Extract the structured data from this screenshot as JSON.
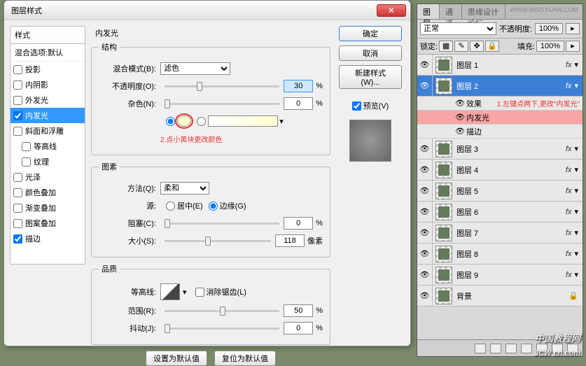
{
  "dialog": {
    "title": "图层样式",
    "styles_header": "样式",
    "blend_options": "混合选项:默认",
    "styles": [
      {
        "label": "投影",
        "checked": false
      },
      {
        "label": "内阴影",
        "checked": false
      },
      {
        "label": "外发光",
        "checked": false
      },
      {
        "label": "内发光",
        "checked": true,
        "selected": true
      },
      {
        "label": "斜面和浮雕",
        "checked": false
      },
      {
        "label": "等高线",
        "checked": false,
        "indent": true
      },
      {
        "label": "纹理",
        "checked": false,
        "indent": true
      },
      {
        "label": "光泽",
        "checked": false
      },
      {
        "label": "颜色叠加",
        "checked": false
      },
      {
        "label": "渐变叠加",
        "checked": false
      },
      {
        "label": "图案叠加",
        "checked": false
      },
      {
        "label": "描边",
        "checked": true
      }
    ],
    "section_title": "内发光",
    "group_struct": "结构",
    "blend_mode_label": "混合模式(B):",
    "blend_mode_value": "滤色",
    "opacity_label": "不透明度(O):",
    "opacity_value": "30",
    "opacity_unit": "%",
    "noise_label": "杂色(N):",
    "noise_value": "0",
    "noise_unit": "%",
    "anno_swatch": "2.点小黄块更改颜色",
    "group_elem": "图素",
    "technique_label": "方法(Q):",
    "technique_value": "柔和",
    "source_label": "源:",
    "source_center": "居中(E)",
    "source_edge": "边缘(G)",
    "choke_label": "阻塞(C):",
    "choke_value": "0",
    "choke_unit": "%",
    "size_label": "大小(S):",
    "size_value": "118",
    "size_unit": "像素",
    "group_quality": "品质",
    "contour_label": "等高线:",
    "antialias_label": "消除锯齿(L)",
    "range_label": "范围(R):",
    "range_value": "50",
    "range_unit": "%",
    "jitter_label": "抖动(J):",
    "jitter_value": "0",
    "jitter_unit": "%",
    "set_default": "设置为默认值",
    "reset_default": "复位为默认值",
    "ok": "确定",
    "cancel": "取消",
    "new_style": "新建样式(W)...",
    "preview_label": "预览(V)"
  },
  "panel": {
    "tab_layers": "图层",
    "tab_channels": "通道",
    "tab_forum": "思缘设计论坛",
    "url": "WWW.MISSYUAN.COM",
    "blend_mode": "正常",
    "opacity_label": "不透明度:",
    "opacity_value": "100%",
    "lock_label": "锁定:",
    "fill_label": "填充:",
    "fill_value": "100%",
    "anno_click": "1.左键点两下,更改\"内发光\"",
    "fx_label": "fx",
    "effects_label": "效果",
    "inner_glow": "内发光",
    "stroke": "描边",
    "layers": [
      {
        "name": "图层 1",
        "fx": true
      },
      {
        "name": "图层 2",
        "fx": true,
        "selected": true,
        "expanded": true
      },
      {
        "name": "图层 3",
        "fx": true
      },
      {
        "name": "图层 4",
        "fx": true
      },
      {
        "name": "图层 5",
        "fx": true
      },
      {
        "name": "图层 6",
        "fx": true
      },
      {
        "name": "图层 7",
        "fx": true
      },
      {
        "name": "图层 8",
        "fx": true
      },
      {
        "name": "图层 9",
        "fx": true
      },
      {
        "name": "背景",
        "locked": true
      }
    ]
  },
  "watermark": {
    "cn": "中国教程网",
    "en": "JCW cn.com"
  }
}
